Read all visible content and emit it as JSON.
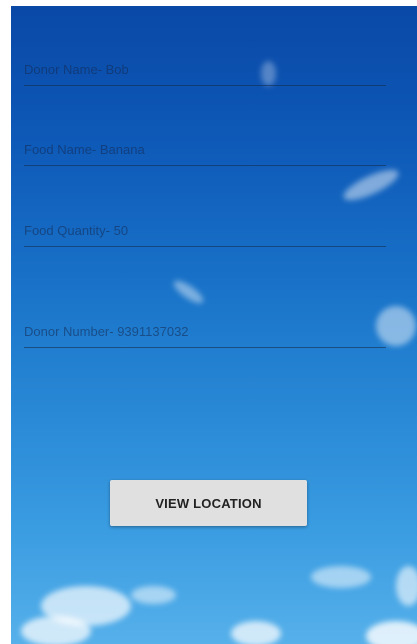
{
  "form": {
    "donor_name": "Donor Name- Bob",
    "food_name": "Food Name- Banana",
    "food_quantity": "Food Quantity- 50",
    "donor_number": "Donor Number- 9391137032"
  },
  "actions": {
    "view_location_label": "VIEW LOCATION"
  },
  "colors": {
    "sky_top": "#0a48a6",
    "sky_bottom": "#56b0ea",
    "button_bg": "#e0e0e0"
  }
}
